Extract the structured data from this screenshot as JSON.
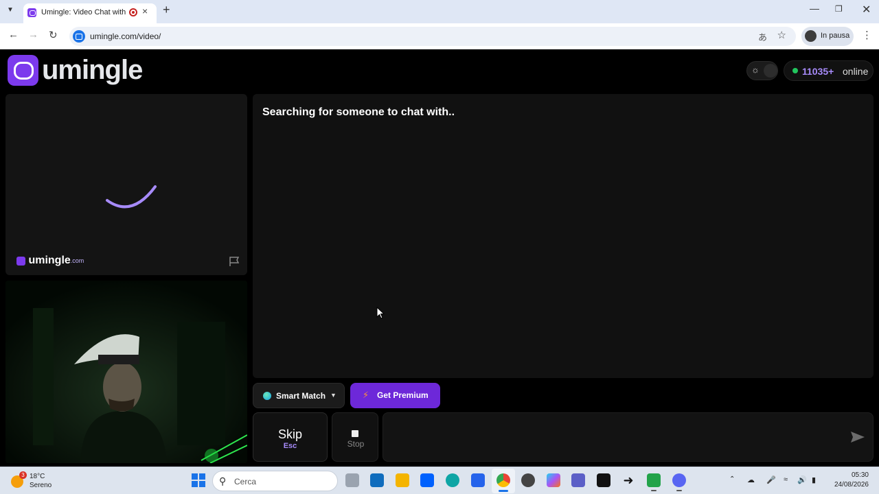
{
  "browser": {
    "tab_title": "Umingle: Video Chat with S",
    "new_tab": "+",
    "url": "umingle.com/video/",
    "profile_label": "In pausa",
    "window_controls": [
      "minimize",
      "restore",
      "close"
    ]
  },
  "header": {
    "logo_text": "umingle",
    "online_count": "11035+",
    "online_label": "online"
  },
  "stranger_panel": {
    "watermark_name": "umingle",
    "watermark_domain": ".com",
    "report_icon": "flag-icon"
  },
  "chat": {
    "status": "Searching for someone to chat with.."
  },
  "controls": {
    "match_mode": "Smart Match",
    "premium_label": "Get Premium",
    "skip_label": "Skip",
    "skip_key": "Esc",
    "stop_label": "Stop",
    "message_value": "",
    "send_icon": "send-icon"
  },
  "taskbar": {
    "weather_temp": "18°C",
    "weather_cond": "Sereno",
    "weather_badge": "3",
    "search_placeholder": "Cerca",
    "time": "05:30",
    "date": "24/08/2026",
    "apps": [
      "file-explorer-icon",
      "outlook-icon",
      "folder-icon",
      "dropbox-icon",
      "edge-icon",
      "store-icon",
      "chrome-icon",
      "obs-icon",
      "copilot-icon",
      "teams-icon",
      "amazon-icon",
      "terminal-icon",
      "discord-icon",
      "discord-icon"
    ]
  },
  "colors": {
    "brand": "#7c3aed",
    "premium": "#6d28d9",
    "online_dot": "#22c55e",
    "online_count": "#a78bfa"
  }
}
